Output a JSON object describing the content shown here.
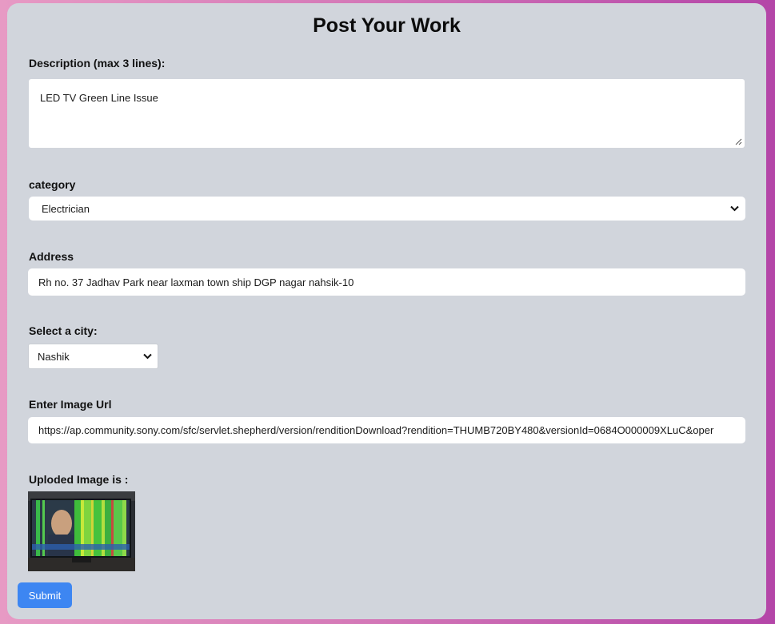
{
  "form": {
    "title": "Post Your Work",
    "description": {
      "label": "Description (max 3 lines):",
      "value": "LED TV Green Line Issue"
    },
    "category": {
      "label": "category",
      "selected": "Electrician",
      "icon": "chevron-down-icon"
    },
    "address": {
      "label": "Address",
      "value": "Rh no. 37 Jadhav Park near laxman town ship DGP nagar nahsik-10"
    },
    "city": {
      "label": "Select a city:",
      "selected": "Nashik",
      "icon": "chevron-down-icon"
    },
    "image_url": {
      "label": "Enter Image Url",
      "value": "https://ap.community.sony.com/sfc/servlet.shepherd/version/renditionDownload?rendition=THUMB720BY480&versionId=0684O000009XLuC&oper"
    },
    "uploaded": {
      "label": "Uploded Image is :"
    },
    "submit_label": "Submit"
  },
  "colors": {
    "card_background": "#d1d5dc",
    "submit_button": "#3d86f2",
    "page_gradient_start": "#e79ac4",
    "page_gradient_end": "#b445a8"
  }
}
